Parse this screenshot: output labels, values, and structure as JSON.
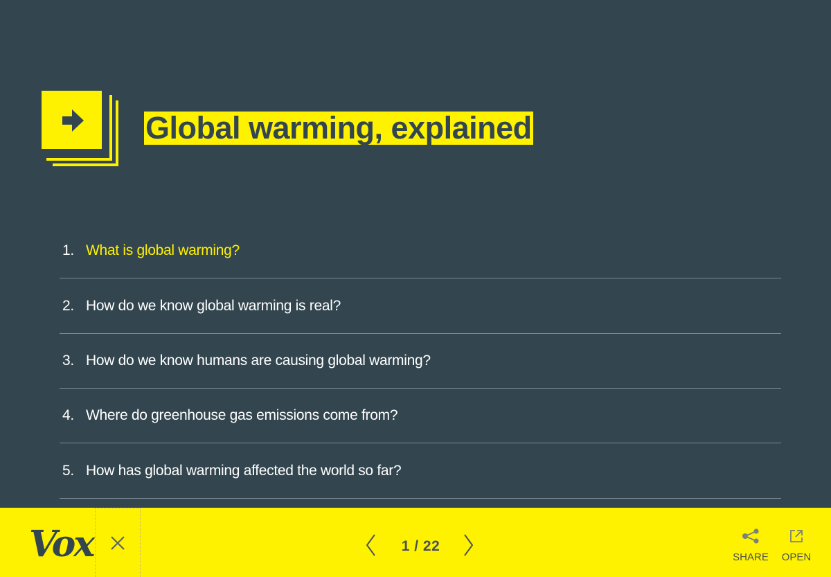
{
  "header": {
    "title": "Global warming, explained"
  },
  "toc": {
    "items": [
      {
        "number": "1.",
        "label": "What is global warming?",
        "active": true
      },
      {
        "number": "2.",
        "label": "How do we know global warming is real?",
        "active": false
      },
      {
        "number": "3.",
        "label": "How do we know humans are causing global warming?",
        "active": false
      },
      {
        "number": "4.",
        "label": "Where do greenhouse gas emissions come from?",
        "active": false
      },
      {
        "number": "5.",
        "label": "How has global warming affected the world so far?",
        "active": false
      }
    ]
  },
  "bottombar": {
    "logo": "Vox",
    "close_icon": "close-icon",
    "pager": {
      "current": "1",
      "separator": "/",
      "total": "22",
      "display": "1 / 22"
    },
    "share_label": "SHARE",
    "open_label": "OPEN"
  },
  "colors": {
    "background": "#33464f",
    "accent": "#fff200",
    "text": "#ffffff",
    "divider": "#7b8a90"
  }
}
